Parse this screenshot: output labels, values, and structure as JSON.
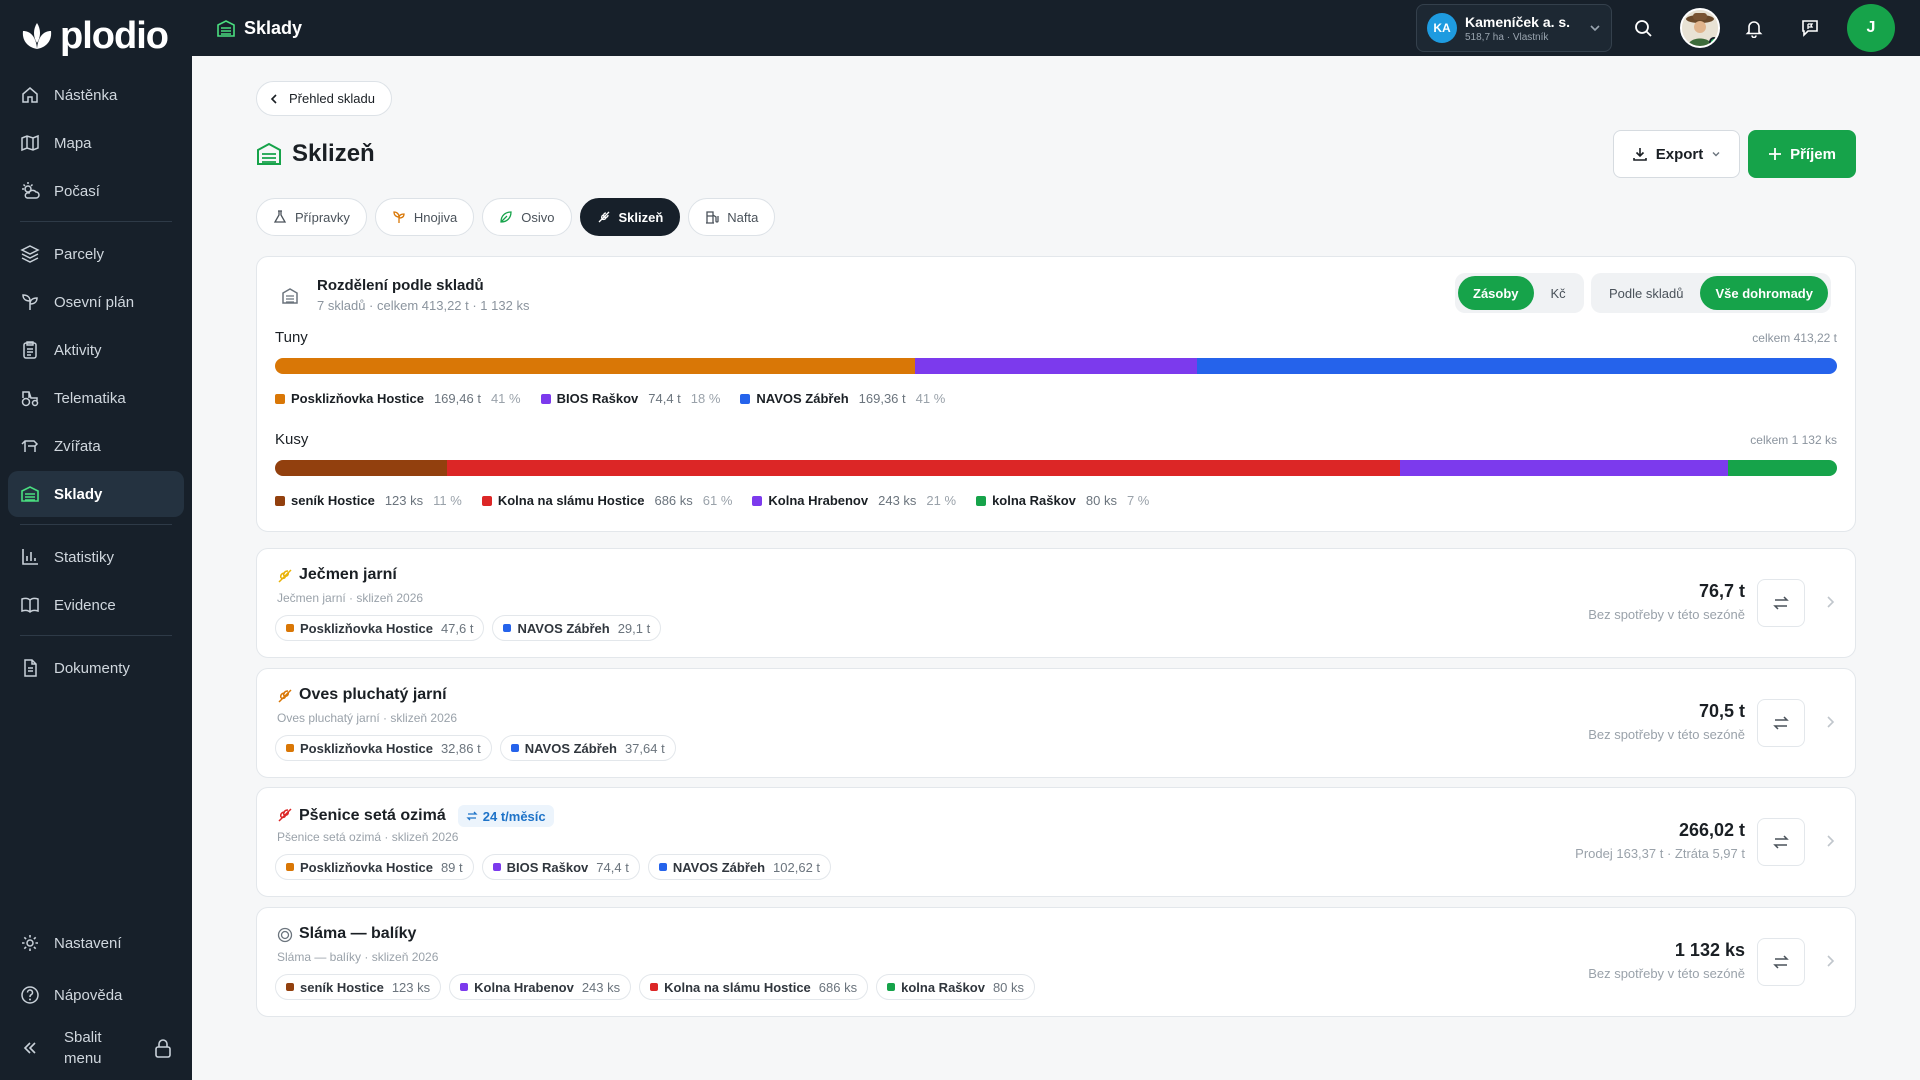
{
  "app": {
    "logo_text": "plodio"
  },
  "sidebar": {
    "items": [
      {
        "label": "Nástěnka",
        "icon": "home-icon"
      },
      {
        "label": "Mapa",
        "icon": "map-icon"
      },
      {
        "label": "Počasí",
        "icon": "weather-icon"
      },
      {
        "label": "Parcely",
        "icon": "layers-icon"
      },
      {
        "label": "Osevní plán",
        "icon": "sprout-icon"
      },
      {
        "label": "Aktivity",
        "icon": "clipboard-icon"
      },
      {
        "label": "Telematika",
        "icon": "tractor-icon"
      },
      {
        "label": "Zvířata",
        "icon": "animal-icon"
      },
      {
        "label": "Sklady",
        "icon": "warehouse-icon"
      },
      {
        "label": "Statistiky",
        "icon": "chart-icon"
      },
      {
        "label": "Evidence",
        "icon": "book-icon"
      },
      {
        "label": "Dokumenty",
        "icon": "document-icon"
      }
    ],
    "bottom": [
      {
        "label": "Nastavení",
        "icon": "gear-icon"
      },
      {
        "label": "Nápověda",
        "icon": "help-icon"
      }
    ],
    "collapse_line1": "Sbalit",
    "collapse_line2": "menu"
  },
  "topbar": {
    "title": "Sklady",
    "org_initials": "KA",
    "org_name": "Kameníček a. s.",
    "org_sub": "518,7 ha · Vlastník",
    "user_initial": "J"
  },
  "page": {
    "back_label": "Přehled skladu",
    "title": "Sklizeň",
    "export_label": "Export",
    "prijem_label": "Příjem",
    "tabs": [
      {
        "label": "Přípravky"
      },
      {
        "label": "Hnojiva"
      },
      {
        "label": "Osivo"
      },
      {
        "label": "Sklizeň",
        "active": true
      },
      {
        "label": "Nafta"
      }
    ]
  },
  "distribution": {
    "title": "Rozdělení podle skladů",
    "subtitle": "7 skladů · celkem 413,22 t · 1 132 ks",
    "toggle1": [
      "Zásoby",
      "Kč"
    ],
    "toggle2": [
      "Podle skladů",
      "Vše dohromady"
    ],
    "tuny": {
      "label": "Tuny",
      "total": "celkem 413,22 t",
      "segments": [
        {
          "name": "Posklizňovka Hostice",
          "value": "169,46 t",
          "pct": "41 %",
          "share": 41,
          "color": "#d97706"
        },
        {
          "name": "BIOS Raškov",
          "value": "74,4 t",
          "pct": "18 %",
          "share": 18,
          "color": "#7c3aed"
        },
        {
          "name": "NAVOS Zábřeh",
          "value": "169,36 t",
          "pct": "41 %",
          "share": 41,
          "color": "#2563eb"
        }
      ]
    },
    "kusy": {
      "label": "Kusy",
      "total": "celkem 1 132 ks",
      "segments": [
        {
          "name": "seník Hostice",
          "value": "123 ks",
          "pct": "11 %",
          "share": 11,
          "color": "#92400e"
        },
        {
          "name": "Kolna na slámu Hostice",
          "value": "686 ks",
          "pct": "61 %",
          "share": 61,
          "color": "#dc2626"
        },
        {
          "name": "Kolna Hrabenov",
          "value": "243 ks",
          "pct": "21 %",
          "share": 21,
          "color": "#7c3aed"
        },
        {
          "name": "kolna Raškov",
          "value": "80 ks",
          "pct": "7 %",
          "share": 7,
          "color": "#16a34a"
        }
      ]
    }
  },
  "crops": [
    {
      "name": "Ječmen jarní",
      "sub": "Ječmen jarní · sklizeň 2026",
      "qty": "76,7 t",
      "note": "Bez spotřeby v této sezóně",
      "icon_color": "#eab308",
      "chips": [
        {
          "name": "Posklizňovka Hostice",
          "value": "47,6 t",
          "color": "#d97706"
        },
        {
          "name": "NAVOS Zábřeh",
          "value": "29,1 t",
          "color": "#2563eb"
        }
      ]
    },
    {
      "name": "Oves pluchatý jarní",
      "sub": "Oves pluchatý jarní · sklizeň 2026",
      "qty": "70,5 t",
      "note": "Bez spotřeby v této sezóně",
      "icon_color": "#d97706",
      "chips": [
        {
          "name": "Posklizňovka Hostice",
          "value": "32,86 t",
          "color": "#d97706"
        },
        {
          "name": "NAVOS Zábřeh",
          "value": "37,64 t",
          "color": "#2563eb"
        }
      ]
    },
    {
      "name": "Pšenice setá ozimá",
      "rate": "24 t/měsíc",
      "sub": "Pšenice setá ozimá · sklizeň 2026",
      "qty": "266,02 t",
      "note": "Prodej 163,37 t · Ztráta 5,97 t",
      "icon_color": "#dc2626",
      "chips": [
        {
          "name": "Posklizňovka Hostice",
          "value": "89 t",
          "color": "#d97706"
        },
        {
          "name": "BIOS Raškov",
          "value": "74,4 t",
          "color": "#7c3aed"
        },
        {
          "name": "NAVOS Zábřeh",
          "value": "102,62 t",
          "color": "#2563eb"
        }
      ]
    },
    {
      "name": "Sláma — balíky",
      "sub": "Sláma — balíky · sklizeň 2026",
      "qty": "1 132 ks",
      "note": "Bez spotřeby v této sezóně",
      "icon_color": "#6b747d",
      "chips": [
        {
          "name": "seník Hostice",
          "value": "123 ks",
          "color": "#92400e"
        },
        {
          "name": "Kolna Hrabenov",
          "value": "243 ks",
          "color": "#7c3aed"
        },
        {
          "name": "Kolna na slámu Hostice",
          "value": "686 ks",
          "color": "#dc2626"
        },
        {
          "name": "kolna Raškov",
          "value": "80 ks",
          "color": "#16a34a"
        }
      ]
    }
  ]
}
